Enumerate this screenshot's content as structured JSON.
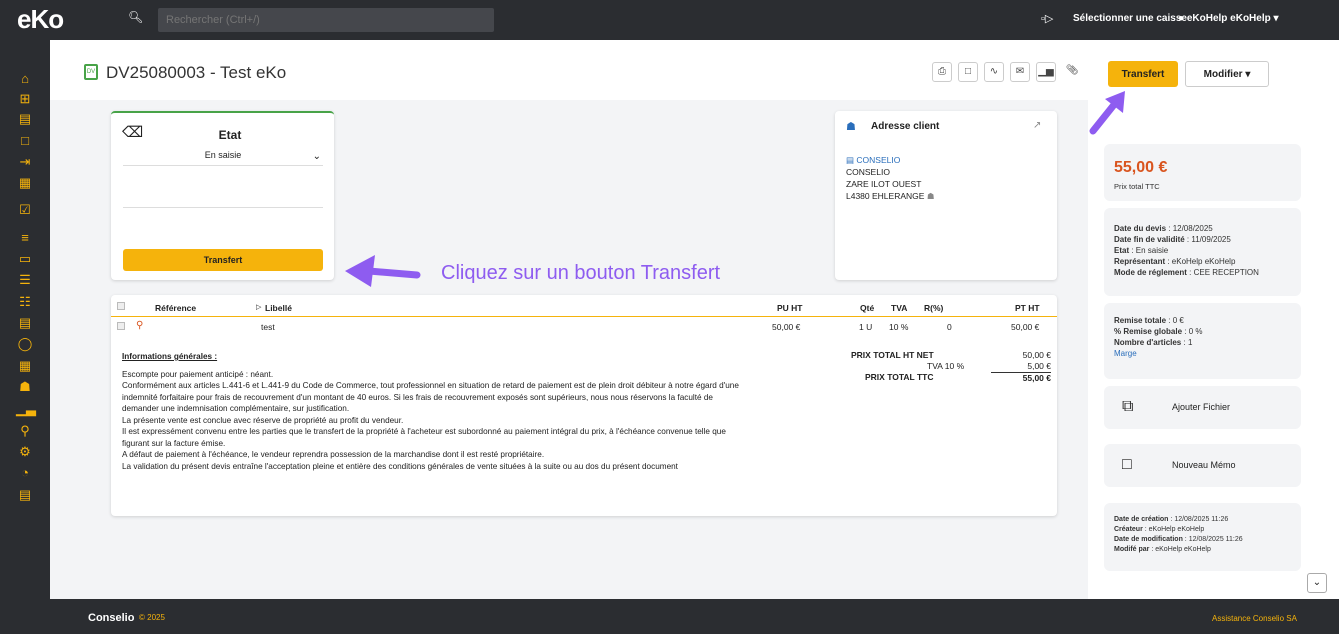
{
  "topbar": {
    "logo": "eKo",
    "search_placeholder": "Rechercher (Ctrl+/)",
    "caisse_label": "Sélectionner une caisse",
    "user_label": "eKoHelp eKoHelp"
  },
  "sidebar": {
    "icons": [
      "home-icon",
      "plus-square-icon",
      "document-icon",
      "file-icon",
      "file-export-icon",
      "calendar-icon",
      "calendar-check-icon",
      "list-icon",
      "folder-icon",
      "tasks-icon",
      "sitemap-icon",
      "stack-icon",
      "stopwatch-icon",
      "calculator-icon",
      "building-icon",
      "bar-chart-icon",
      "search-icon",
      "users-cog-icon",
      "pie-chart-icon",
      "server-icon"
    ]
  },
  "header": {
    "doc_badge": "DV",
    "title": "DV25080003 - Test eKo",
    "transfert_label": "Transfert",
    "modifier_label": "Modifier"
  },
  "etat": {
    "title": "Etat",
    "selected": "En saisie",
    "transfert_label": "Transfert"
  },
  "annotation": {
    "text": "Cliquez sur un bouton Transfert",
    "color": "#8e5cf0"
  },
  "client": {
    "title": "Adresse client",
    "link": "CONSELIO",
    "lines": [
      "CONSELIO",
      "ZARE ILOT OUEST",
      "L4380 EHLERANGE"
    ]
  },
  "table": {
    "headers": [
      "Référence",
      "Libellé",
      "PU HT",
      "Qté",
      "TVA",
      "R(%)",
      "PT HT"
    ],
    "rows": [
      {
        "ref": "",
        "libelle": "test",
        "pu": "50,00 €",
        "qte": "1 U",
        "tva": "10 %",
        "r": "0",
        "pt": "50,00 €"
      }
    ]
  },
  "totals": {
    "ht_label": "PRIX TOTAL HT NET",
    "ht_value": "50,00 €",
    "tva_label": "TVA 10 %",
    "tva_value": "5,00 €",
    "ttc_label": "PRIX TOTAL TTC",
    "ttc_value": "55,00 €"
  },
  "info": {
    "title": "Informations générales :",
    "lines": [
      "Escompte pour paiement anticipé : néant.",
      "Conformément aux articles L.441-6 et L.441-9 du Code de Commerce, tout professionnel en situation de retard de paiement est de plein droit débiteur à notre égard d'une",
      "indemnité forfaitaire pour frais de recouvrement d'un montant de 40 euros. Si les frais de recouvrement exposés sont supérieurs, nous nous réservons la faculté de",
      "demander une indemnisation complémentaire, sur justification.",
      "La présente vente est conclue avec réserve de propriété au profit du vendeur.",
      "Il est expressément convenu entre les parties que le transfert de la propriété à l'acheteur est subordonné au paiement intégral du prix, à l'échéance convenue telle que",
      "figurant sur la facture émise.",
      "A défaut de paiement à l'échéance, le vendeur reprendra possession de la marchandise dont il est resté propriétaire.",
      "La validation du présent devis entraîne l'acceptation pleine et entière des conditions générales de vente situées à la suite ou au dos du présent document"
    ]
  },
  "summary": {
    "price": "55,00 €",
    "price_label": "Prix total TTC",
    "date_devis_l": "Date du devis",
    "date_devis_v": "12/08/2025",
    "date_fin_l": "Date fin de validité",
    "date_fin_v": "11/09/2025",
    "etat_l": "Etat",
    "etat_v": "En saisie",
    "rep_l": "Représentant",
    "rep_v": "eKoHelp eKoHelp",
    "mode_l": "Mode de réglement",
    "mode_v": "CEE RECEPTION",
    "remise_l": "Remise totale",
    "remise_v": "0 €",
    "remise_g_l": "% Remise globale",
    "remise_g_v": "0 %",
    "nb_l": "Nombre d'articles",
    "nb_v": "1",
    "marge": "Marge",
    "ajouter_fichier": "Ajouter Fichier",
    "nouveau_memo": "Nouveau Mémo",
    "creation_l": "Date de création",
    "creation_v": "12/08/2025 11:26",
    "createur_l": "Créateur",
    "createur_v": "eKoHelp eKoHelp",
    "modif_l": "Date de modification",
    "modif_v": "12/08/2025 11:26",
    "modifie_l": "Modifé par",
    "modifie_v": "eKoHelp eKoHelp"
  },
  "footer": {
    "brand": "Conselio",
    "year": "© 2025",
    "assist": "Assistance Conselio SA"
  },
  "colors": {
    "accent": "#f5b30c",
    "price": "#d9541e",
    "link": "#2a6ebb"
  }
}
